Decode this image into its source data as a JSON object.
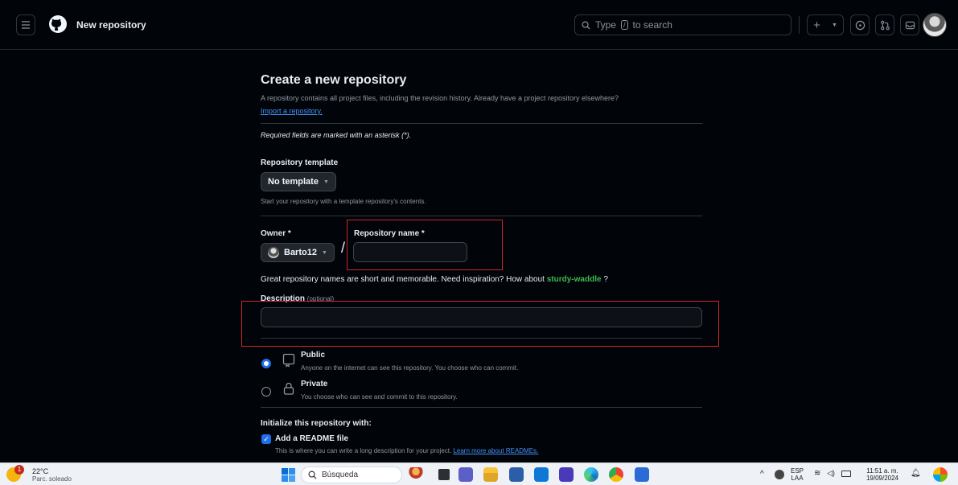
{
  "header": {
    "title": "New repository",
    "search_prefix": "Type",
    "search_key": "/",
    "search_suffix": "to search",
    "new_button": "+"
  },
  "page": {
    "heading": "Create a new repository",
    "lead": "A repository contains all project files, including the revision history. Already have a project repository elsewhere?",
    "import_link": "Import a repository.",
    "required_note": "Required fields are marked with an asterisk (*).",
    "template_label": "Repository template",
    "template_value": "No template",
    "template_hint": "Start your repository with a template repository's contents.",
    "owner_label": "Owner *",
    "owner_value": "Barto12",
    "slash": "/",
    "repo_name_label": "Repository name *",
    "repo_name_value": "",
    "inspire_text": "Great repository names are short and memorable. Need inspiration? How about",
    "suggestion": "sturdy-waddle",
    "inspire_end": "?",
    "description_label": "Description",
    "description_optional": "(optional)",
    "description_value": "",
    "visibility": [
      {
        "title": "Public",
        "desc": "Anyone on the internet can see this repository. You choose who can commit.",
        "selected": true
      },
      {
        "title": "Private",
        "desc": "You choose who can see and commit to this repository.",
        "selected": false
      }
    ],
    "init_heading": "Initialize this repository with:",
    "readme_label": "Add a README file",
    "readme_desc": "This is where you can write a long description for your project.",
    "readme_link": "Learn more about READMEs."
  },
  "taskbar": {
    "temp": "22°C",
    "condition": "Parc. soleado",
    "weather_badge": "1",
    "search_placeholder": "Búsqueda",
    "lang_top": "ESP",
    "lang_bottom": "LAA",
    "time": "11:51 a. m.",
    "date": "19/09/2024"
  },
  "colors": {
    "accent": "#1f6feb",
    "link": "#4493f8",
    "suggestion": "#3fb950",
    "highlight_box": "#d1242f"
  }
}
